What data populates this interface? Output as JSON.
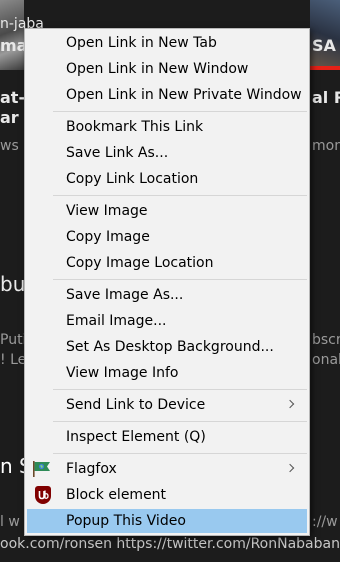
{
  "background": {
    "lines": [
      "n-jaba",
      "mar",
      "at-li",
      "ar",
      "ws •",
      "bul",
      "Putil",
      "! Le",
      "n S",
      "l w",
      "ook.com/ronsen https://twitter.com/RonNababan",
      "SA 2",
      "al Ro",
      "mont",
      "bscr",
      "onalo",
      "://w"
    ]
  },
  "menu": {
    "items": [
      {
        "label": "Open Link in New Tab",
        "submenu": false
      },
      {
        "label": "Open Link in New Window",
        "submenu": false
      },
      {
        "label": "Open Link in New Private Window",
        "submenu": false
      },
      {
        "label": "Bookmark This Link",
        "submenu": false
      },
      {
        "label": "Save Link As...",
        "submenu": false
      },
      {
        "label": "Copy Link Location",
        "submenu": false
      },
      {
        "label": "View Image",
        "submenu": false
      },
      {
        "label": "Copy Image",
        "submenu": false
      },
      {
        "label": "Copy Image Location",
        "submenu": false
      },
      {
        "label": "Save Image As...",
        "submenu": false
      },
      {
        "label": "Email Image...",
        "submenu": false
      },
      {
        "label": "Set As Desktop Background...",
        "submenu": false
      },
      {
        "label": "View Image Info",
        "submenu": false
      },
      {
        "label": "Send Link to Device",
        "submenu": true
      },
      {
        "label": "Inspect Element (Q)",
        "submenu": false
      },
      {
        "label": "Flagfox",
        "submenu": true,
        "icon": "flag-icon"
      },
      {
        "label": "Block element",
        "submenu": false,
        "icon": "ublock-icon"
      },
      {
        "label": "Popup This Video",
        "submenu": false,
        "selected": true
      }
    ]
  },
  "colors": {
    "selection": "#99c9ef",
    "menu_bg": "#f2f2f2",
    "page_bg": "#1c1c1c"
  }
}
